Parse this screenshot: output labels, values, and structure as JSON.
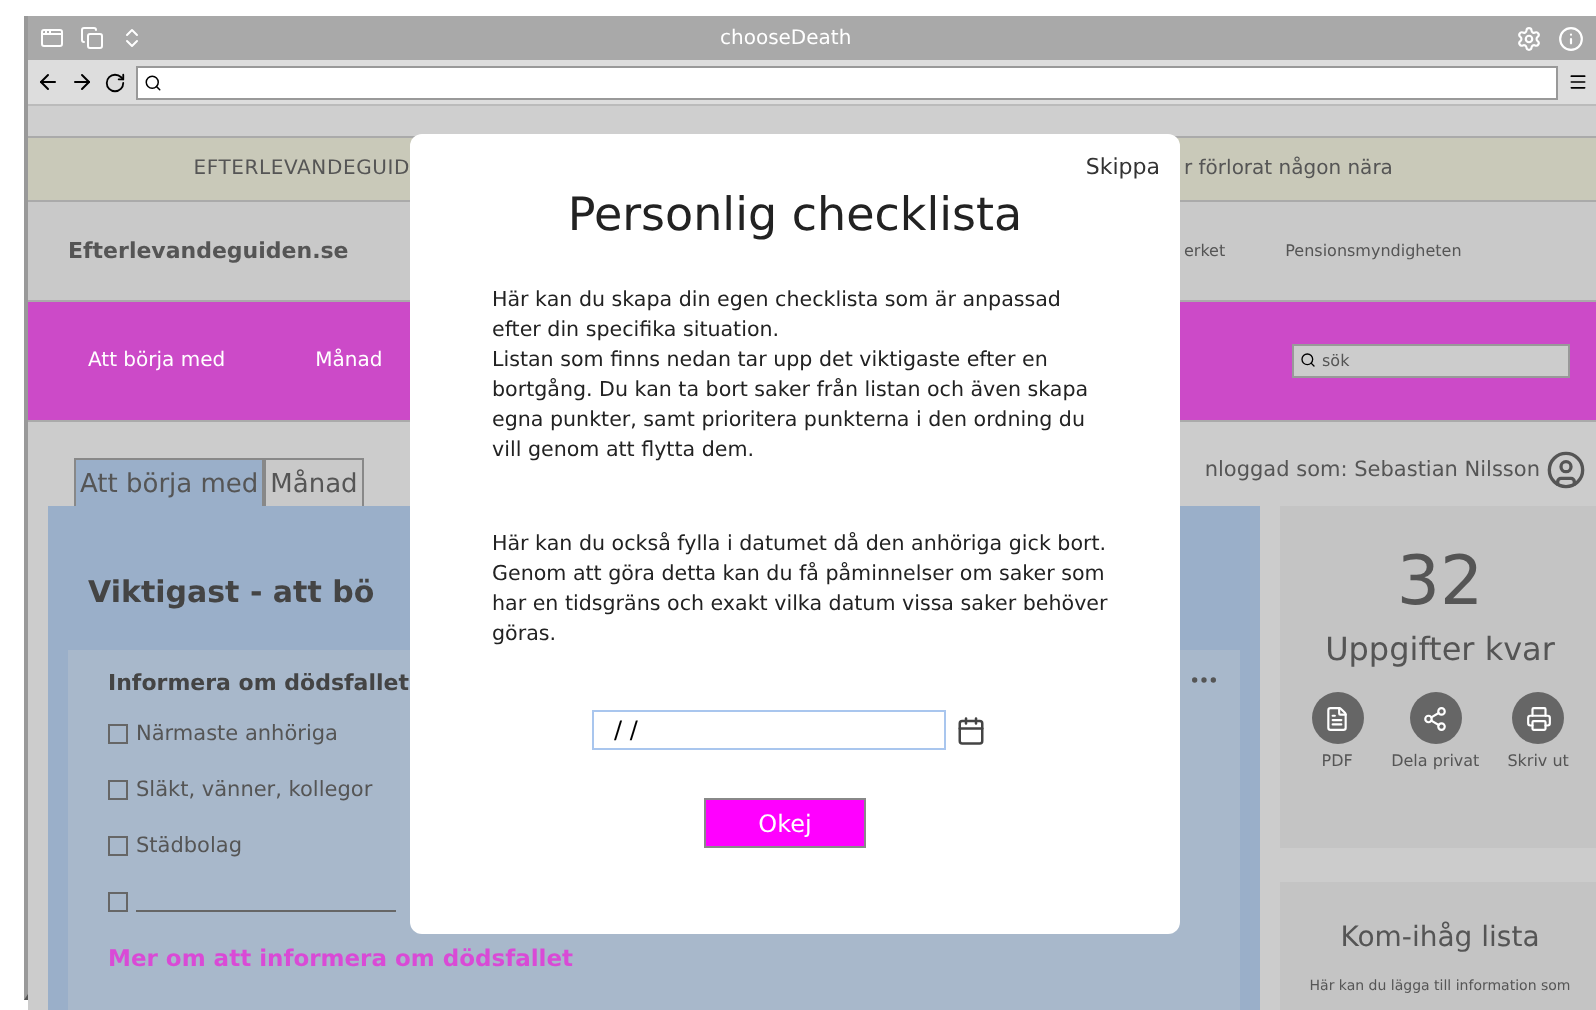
{
  "browser": {
    "title": "chooseDeath"
  },
  "banner": {
    "left": "EFTERLEVANDEGUID",
    "right": "r förlorat någon nära"
  },
  "header": {
    "logo": "Efterlevandeguiden.se",
    "links": [
      "erket",
      "Pensionsmyndigheten"
    ]
  },
  "nav": {
    "items": [
      "Att börja med",
      "Månad"
    ],
    "search": {
      "placeholder": "sök"
    }
  },
  "tabs": [
    {
      "label": "Att börja med",
      "selected": true
    },
    {
      "label": "Månad",
      "selected": false
    }
  ],
  "user": {
    "label": "nloggad som: Sebastian Nilsson"
  },
  "main": {
    "title": "Viktigast - att bö",
    "section": {
      "heading": "Informera om dödsfallet",
      "items": [
        {
          "kind": "text",
          "label": "Närmaste anhöriga",
          "checked": false
        },
        {
          "kind": "text",
          "label": "Släkt, vänner, kollegor",
          "checked": false
        },
        {
          "kind": "text",
          "label": "Städbolag",
          "checked": false
        },
        {
          "kind": "blank",
          "checked": false
        }
      ],
      "link": "Mer om att informera om dödsfallet"
    }
  },
  "summary": {
    "count": "32",
    "label": "Uppgifter kvar",
    "actions": [
      {
        "kind": "pdf",
        "label": "PDF"
      },
      {
        "kind": "share",
        "label": "Dela privat"
      },
      {
        "kind": "print",
        "label": "Skriv ut"
      }
    ]
  },
  "reminder": {
    "title": "Kom-ihåg lista",
    "text": "Här kan du lägga till information som"
  },
  "modal": {
    "skip": "Skippa",
    "title": "Personlig checklista",
    "paragraphs": [
      "Här kan du skapa din egen checklista som är anpassad efter din specifika situation.",
      "Listan som finns nedan tar upp det viktigaste efter en bortgång. Du kan ta bort saker från listan och även skapa egna punkter, samt prioritera punkterna i den ordning du vill genom att flytta dem.",
      "Här kan du också fylla i datumet då den anhöriga gick bort. Genom att göra detta kan du få påminnelser om saker som har en tidsgräns och exakt vilka datum vissa saker behöver göras."
    ],
    "date": {
      "value": "/ /"
    },
    "button": "Okej"
  }
}
